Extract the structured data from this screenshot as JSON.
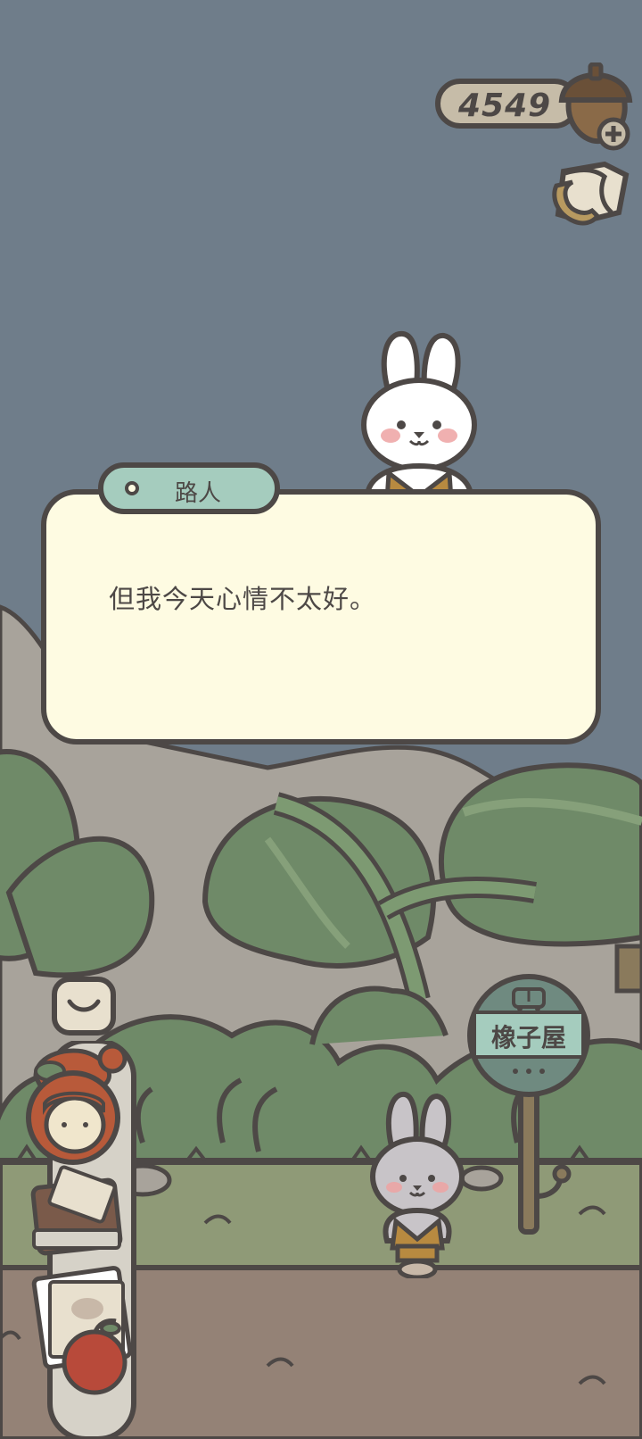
{
  "hud": {
    "acorn_count": "4549",
    "currency_icon": "acorn-icon",
    "add_icon": "plus-icon",
    "map_icon": "map-icon"
  },
  "dialog": {
    "speaker": "路人",
    "text": "但我今天心情不太好。"
  },
  "bus_stop": {
    "sign_text": "橡子屋",
    "sign_icon": "bus-icon"
  },
  "left_tools": {
    "collapse_icon": "chevron-down-icon",
    "items": [
      "hat-icon",
      "character-icon",
      "notebook-icon",
      "photo-album-icon",
      "apple-icon"
    ]
  },
  "colors": {
    "sky": "#6f7d8a",
    "outline": "#4d4846",
    "dialog_bg": "#fefbe2",
    "name_tag": "#a5ccbe",
    "leaf": "#6f8a68",
    "ground": "#948276",
    "grass": "#8f9a77",
    "mountain": "#a8a39b"
  }
}
